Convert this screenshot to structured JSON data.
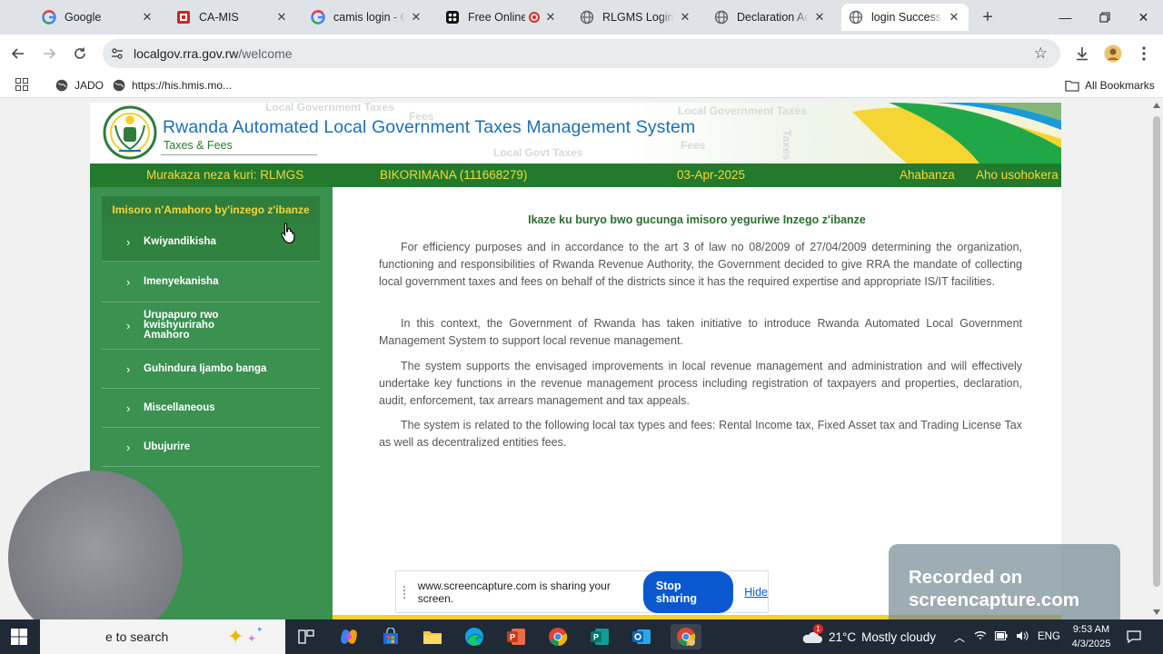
{
  "browser": {
    "tabs": [
      {
        "title": "Google",
        "icon": "google-icon",
        "active": false
      },
      {
        "title": "CA-MIS",
        "icon": "camis-icon",
        "active": false
      },
      {
        "title": "camis login - Go",
        "icon": "google-icon",
        "active": false
      },
      {
        "title": "Free Online",
        "icon": "screencapture-icon",
        "active": false
      },
      {
        "title": "RLGMS Login",
        "icon": "globe-icon",
        "active": false
      },
      {
        "title": "Declaration Ackn",
        "icon": "globe-icon",
        "active": false
      },
      {
        "title": "login Success",
        "icon": "globe-icon",
        "active": true
      }
    ],
    "url_host": "localgov.rra.gov.rw",
    "url_path": "/welcome",
    "bookmarks": [
      {
        "label": "JADO"
      },
      {
        "label": "https://his.hmis.mo..."
      }
    ],
    "all_bookmarks_label": "All Bookmarks"
  },
  "site": {
    "title": "Rwanda Automated Local Government Taxes Management System",
    "subtitle": "Taxes & Fees",
    "banner_watermarks": [
      "Local Government Taxes",
      "Fees",
      "Local Government Taxes",
      "Local Govt Taxes",
      "Fees",
      "Taxes"
    ],
    "greenbar": {
      "welcome": "Murakaza neza kuri: RLMGS",
      "user": "BIKORIMANA (111668279)",
      "date": "03-Apr-2025",
      "home_link": "Ahabanza",
      "logout_link": "Aho usohokera"
    },
    "sidebar": {
      "heading": "Imisoro n'Amahoro by'inzego z'ibanze",
      "items": [
        {
          "label": "Kwiyandikisha",
          "active": true
        },
        {
          "label": "Imenyekanisha",
          "active": false
        },
        {
          "label": "Urupapuro rwo kwishyuriraho Amahoro",
          "active": false
        },
        {
          "label": "Guhindura Ijambo banga",
          "active": false
        },
        {
          "label": "Miscellaneous",
          "active": false
        },
        {
          "label": "Ubujurire",
          "active": false
        }
      ]
    },
    "content": {
      "heading": "Ikaze ku buryo bwo gucunga imisoro yeguriwe Inzego z'ibanze",
      "paragraphs": [
        "For efficiency purposes and in accordance to the art 3 of law no 08/2009 of 27/04/2009 determining the organization, functioning and responsibilities of Rwanda Revenue Authority, the Government decided to give RRA the mandate of collecting local government taxes and fees on behalf of the districts since it has the required expertise and appropriate IS/IT facilities.",
        "In this context, the Government of Rwanda has taken initiative to introduce Rwanda Automated Local Government Management System to support local revenue management.",
        "The system supports the envisaged improvements in local revenue management and administration and will effectively undertake key functions in the revenue management process including registration of taxpayers and properties, declaration, audit, enforcement, tax arrears management and tax appeals.",
        "The system is related to the following local tax types and fees: Rental Income tax, Fixed Asset tax and Trading License Tax as well as decentralized entities fees."
      ]
    }
  },
  "sharing": {
    "message": "www.screencapture.com is sharing your screen.",
    "stop_label": "Stop sharing",
    "hide_label": "Hide"
  },
  "recording_watermark": {
    "line1": "Recorded on",
    "line2": "screencapture.com"
  },
  "taskbar": {
    "search_text": "e to search",
    "weather_temp": "21°C",
    "weather_desc": "Mostly cloudy",
    "language": "ENG",
    "time": "9:53 AM",
    "date": "4/3/2025",
    "weather_badge": "1"
  },
  "colors": {
    "site_green": "#237a2d",
    "sidebar_green": "#3a9150",
    "accent_yellow": "#f5d63c",
    "title_blue": "#1d6fb4",
    "chrome_blue": "#0b57d0"
  }
}
